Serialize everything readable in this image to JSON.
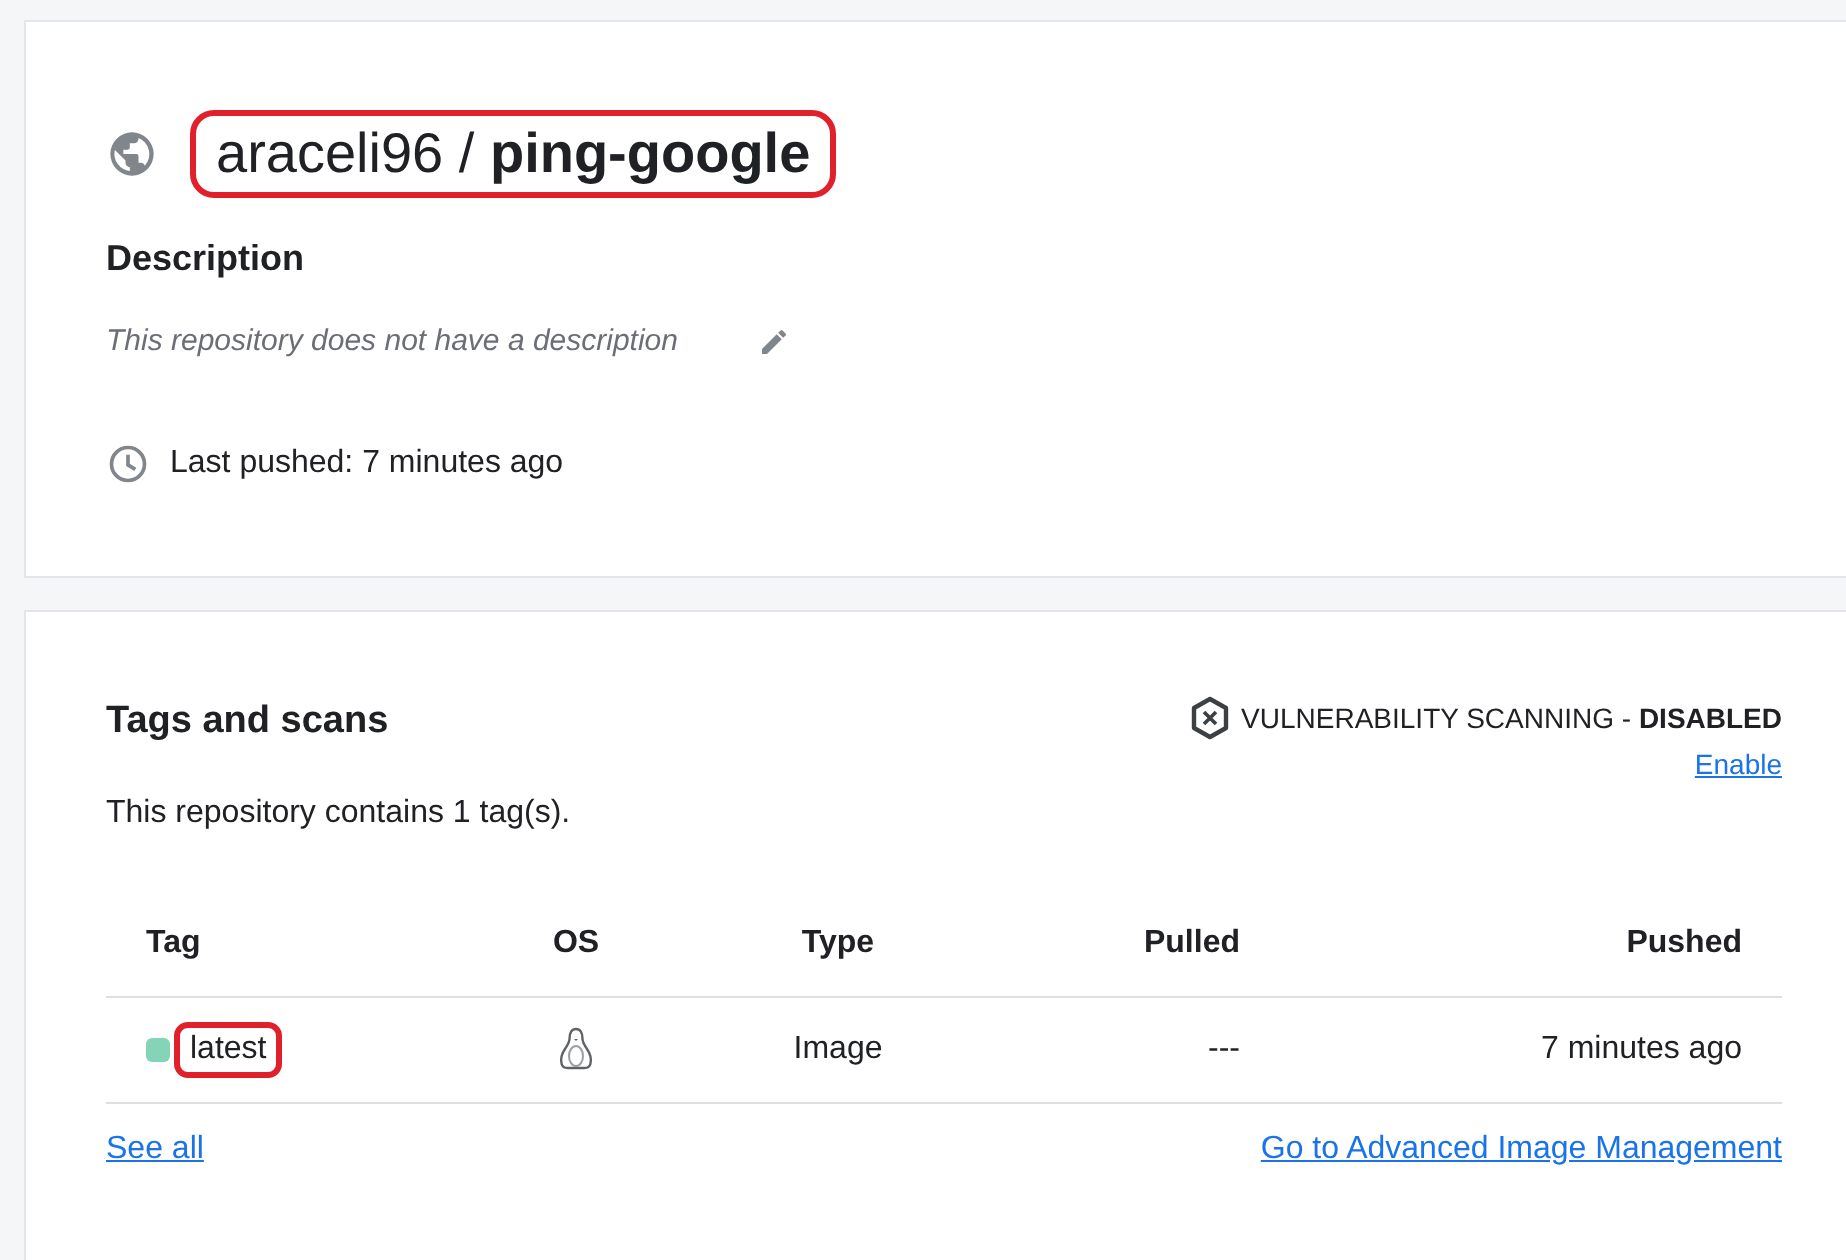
{
  "repository": {
    "title": "araceli96 / **ping-google**",
    "highlighted": true,
    "description_heading": "Description",
    "description": "This repository does not have a description",
    "last_pushed": "Last pushed: 7 minutes ago"
  },
  "tags_section": {
    "heading": "Tags and scans",
    "scanning": "VULNERABILITY SCANNING - **DISABLED**",
    "enable_link": "Enable",
    "summary": "This repository contains 1 tag(s).",
    "table": {
      "columns": [
        "Tag",
        "OS",
        "Type",
        "Pulled",
        "Pushed"
      ],
      "rows": [
        {
          "tag": "latest",
          "color": "#86d4b8",
          "highlighted": true,
          "type": "Image",
          "pulled": "---",
          "pushed": "7 minutes ago"
        }
      ]
    },
    "see_all": "See all",
    "advanced_link": "Go to Advanced Image Management"
  }
}
